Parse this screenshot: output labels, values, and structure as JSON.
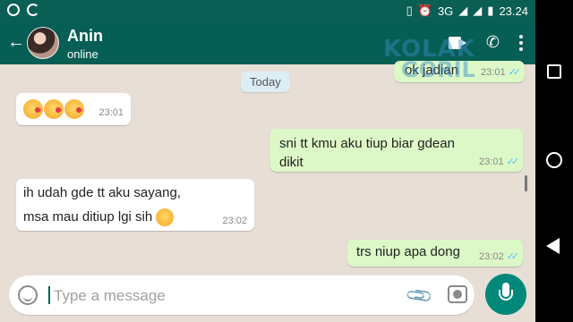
{
  "status_bar": {
    "network": "3G",
    "time": "23.24"
  },
  "header": {
    "contact_name": "Anin",
    "contact_status": "online"
  },
  "date_chip": "Today",
  "watermark": {
    "line1": "KOLAK",
    "line2": "GORIL"
  },
  "messages": [
    {
      "direction": "out",
      "text": "ok jadian",
      "time": "23:01"
    },
    {
      "direction": "in",
      "emoji": "kissing-heart x3",
      "time": "23:01"
    },
    {
      "direction": "out",
      "text": "sni tt kmu aku tiup biar gdean dikit",
      "time": "23:01"
    },
    {
      "direction": "in",
      "line1": "ih udah gde tt aku sayang,",
      "line2": "msa mau ditiup lgi sih",
      "emoji": "blush",
      "time": "23:02"
    },
    {
      "direction": "out",
      "text": "trs niup apa dong",
      "time": "23:02"
    }
  ],
  "input": {
    "placeholder": "Type a message"
  },
  "icons": [
    "back-arrow-icon",
    "video-call-icon",
    "phone-icon",
    "menu-icon",
    "emoji-icon",
    "attach-icon",
    "camera-icon",
    "mic-icon"
  ],
  "colors": {
    "appbar": "#075e54",
    "outgoing": "#dcf8c6",
    "incoming": "#ffffff",
    "mic_button": "#00897b",
    "read_ticks": "#4fc3f7"
  }
}
